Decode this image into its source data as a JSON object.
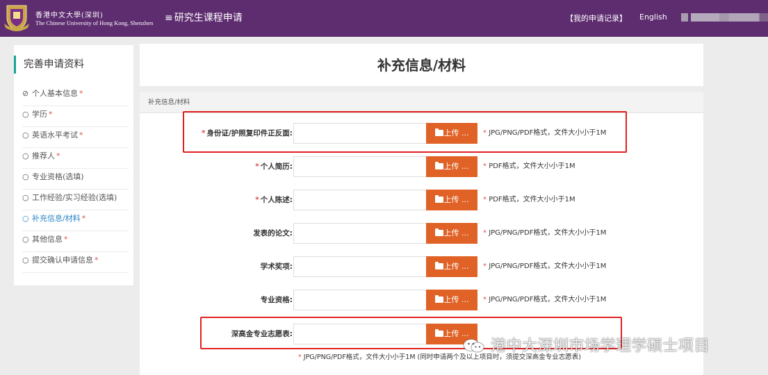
{
  "header": {
    "university_cn": "香港中文大學(深圳)",
    "university_en": "The Chinese University of Hong Kong, Shenzhen",
    "menu_icon": "≡",
    "system_title": "研究生课程申请",
    "my_records": "【我的申请记录】",
    "language": "English",
    "bg_color": "#5e2d70"
  },
  "sidebar": {
    "title": "完善申请资料",
    "accent_color": "#1aa393",
    "items": [
      {
        "mark": "⊘",
        "label": "个人基本信息",
        "required": "*"
      },
      {
        "mark": "○",
        "label": "学历",
        "required": "*"
      },
      {
        "mark": "○",
        "label": "英语水平考试",
        "required": "*"
      },
      {
        "mark": "○",
        "label": "推荐人",
        "required": "*"
      },
      {
        "mark": "○",
        "label": "专业资格(选填)",
        "required": ""
      },
      {
        "mark": "○",
        "label": "工作经验/实习经验(选填)",
        "required": ""
      },
      {
        "mark": "○",
        "label": "补充信息/材料",
        "required": "*",
        "active": true
      },
      {
        "mark": "○",
        "label": "其他信息",
        "required": "*"
      },
      {
        "mark": "○",
        "label": "提交确认申请信息",
        "required": "*"
      }
    ]
  },
  "main": {
    "page_title": "补充信息/材料",
    "panel_heading": "补充信息/材料",
    "upload_label": "上传 ...",
    "upload_icon": "folder-open-icon",
    "upload_color": "#e06226",
    "rows": [
      {
        "required": "*",
        "label": "身份证/护照复印件正反面:",
        "hint_star": "*",
        "hint": "JPG/PNG/PDF格式，文件大小小于1M"
      },
      {
        "required": "*",
        "label": "个人简历:",
        "hint_star": "*",
        "hint": "PDF格式，文件大小小于1M"
      },
      {
        "required": "*",
        "label": "个人陈述:",
        "hint_star": "*",
        "hint": "PDF格式，文件大小小于1M"
      },
      {
        "required": "",
        "label": "发表的论文:",
        "hint_star": "*",
        "hint": "JPG/PNG/PDF格式，文件大小小于1M"
      },
      {
        "required": "",
        "label": "学术奖项:",
        "hint_star": "*",
        "hint": "JPG/PNG/PDF格式，文件大小小于1M"
      },
      {
        "required": "",
        "label": "专业资格:",
        "hint_star": "*",
        "hint": "JPG/PNG/PDF格式，文件大小小于1M"
      },
      {
        "required": "",
        "label": "深高金专业志愿表:",
        "hint_star": "",
        "hint": ""
      }
    ],
    "note_star": "*",
    "note": "JPG/PNG/PDF格式，文件大小小于1M (同时申请两个及以上项目时，须提交深高金专业志愿表)"
  },
  "watermark": {
    "icon": "wechat-icon",
    "text": "港中大深圳市场学理学硕士项目"
  }
}
